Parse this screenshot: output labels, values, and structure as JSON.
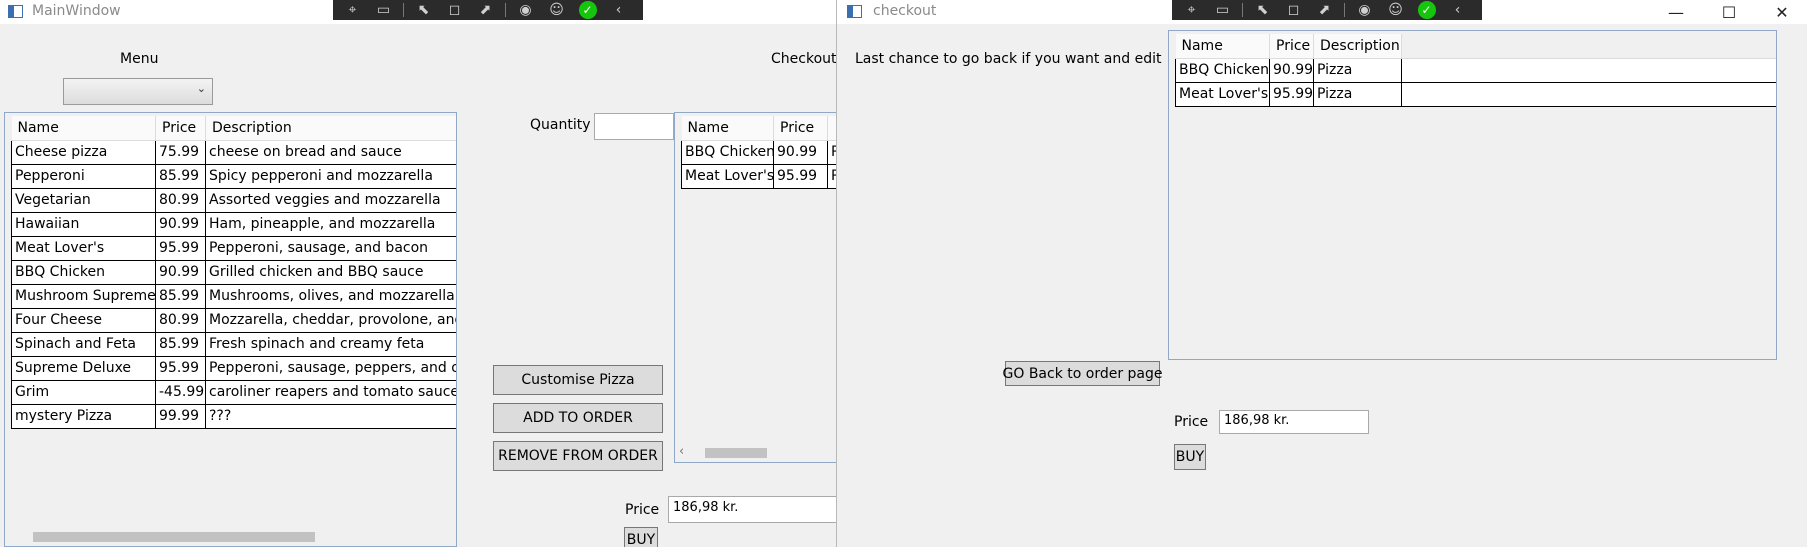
{
  "main_window": {
    "title": "MainWindow",
    "menu_label": "Menu",
    "checkout_label": "Checkout",
    "quantity_label": "Quantity",
    "quantity_value": "",
    "menu_columns": [
      "Name",
      "Price",
      "Description"
    ],
    "menu_rows": [
      [
        "Cheese pizza",
        "75.99",
        "cheese on bread and sauce"
      ],
      [
        "Pepperoni",
        "85.99",
        "Spicy pepperoni and mozzarella"
      ],
      [
        "Vegetarian",
        "80.99",
        "Assorted veggies and mozzarella"
      ],
      [
        "Hawaiian",
        "90.99",
        "Ham, pineapple, and mozzarella"
      ],
      [
        "Meat Lover's",
        "95.99",
        "Pepperoni, sausage, and bacon"
      ],
      [
        "BBQ Chicken",
        "90.99",
        "Grilled chicken and BBQ sauce"
      ],
      [
        "Mushroom Supreme",
        "85.99",
        "Mushrooms, olives, and mozzarella"
      ],
      [
        "Four Cheese",
        "80.99",
        "Mozzarella, cheddar, provolone, and f"
      ],
      [
        "Spinach and Feta",
        "85.99",
        "Fresh spinach and creamy feta"
      ],
      [
        "Supreme Deluxe",
        "95.99",
        "Pepperoni, sausage, peppers, and onic"
      ],
      [
        "Grim",
        "-45.99",
        "caroliner reapers and tomato sauce nc"
      ],
      [
        "mystery Pizza",
        "99.99",
        "???"
      ]
    ],
    "order_columns": [
      "Name",
      "Price",
      ""
    ],
    "order_rows": [
      [
        "BBQ Chicken",
        "90.99",
        "P"
      ],
      [
        "Meat Lover's",
        "95.99",
        "P"
      ]
    ],
    "customise_button": "Customise Pizza",
    "add_button": "ADD TO ORDER",
    "remove_button": "REMOVE FROM ORDER",
    "price_label": "Price",
    "price_value": "186,98 kr.",
    "buy_button": "BUY"
  },
  "checkout_window": {
    "title": "checkout",
    "message": "Last chance to go back if you want and edit",
    "columns": [
      "Name",
      "Price",
      "Description"
    ],
    "rows": [
      [
        "BBQ Chicken",
        "90.99",
        "Pizza"
      ],
      [
        "Meat Lover's",
        "95.99",
        "Pizza"
      ]
    ],
    "back_button": "GO Back to order page",
    "price_label": "Price",
    "price_value": "186,98 kr.",
    "buy_button": "BUY",
    "minimize_glyph": "—",
    "maximize_glyph": "☐",
    "close_glyph": "✕"
  },
  "devtools": [
    "select-element-icon",
    "track-focus-icon",
    "preview-selection-icon",
    "display-layout-adorners-icon",
    "toggle-element-highlight-icon",
    "color-contrast-icon",
    "accessibility-icon",
    "hot-reload-ok-icon",
    "collapse-toolbar-icon"
  ],
  "colors": {
    "hot_reload_ok": "#16c60c",
    "toolbar_bg": "#2b2b2b",
    "grid_border": "#8fa8c8"
  }
}
